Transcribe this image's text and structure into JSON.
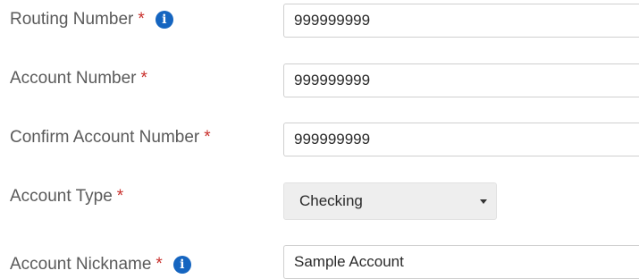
{
  "form": {
    "routing_number": {
      "label": "Routing Number",
      "required_marker": "*",
      "info_icon": "info-icon",
      "value": "999999999"
    },
    "account_number": {
      "label": "Account Number",
      "required_marker": "*",
      "value": "999999999"
    },
    "confirm_account_number": {
      "label": "Confirm Account Number",
      "required_marker": "*",
      "value": "999999999"
    },
    "account_type": {
      "label": "Account Type",
      "required_marker": "*",
      "selected": "Checking",
      "dropdown_icon": "chevron-down-icon"
    },
    "account_nickname": {
      "label": "Account Nickname",
      "required_marker": "*",
      "info_icon": "info-icon",
      "value": "Sample Account"
    }
  },
  "colors": {
    "label_text": "#5a5a5a",
    "required_asterisk": "#c9302c",
    "info_icon": "#1565c0",
    "input_border": "#cfcfcf",
    "select_background": "#eeeeee"
  }
}
